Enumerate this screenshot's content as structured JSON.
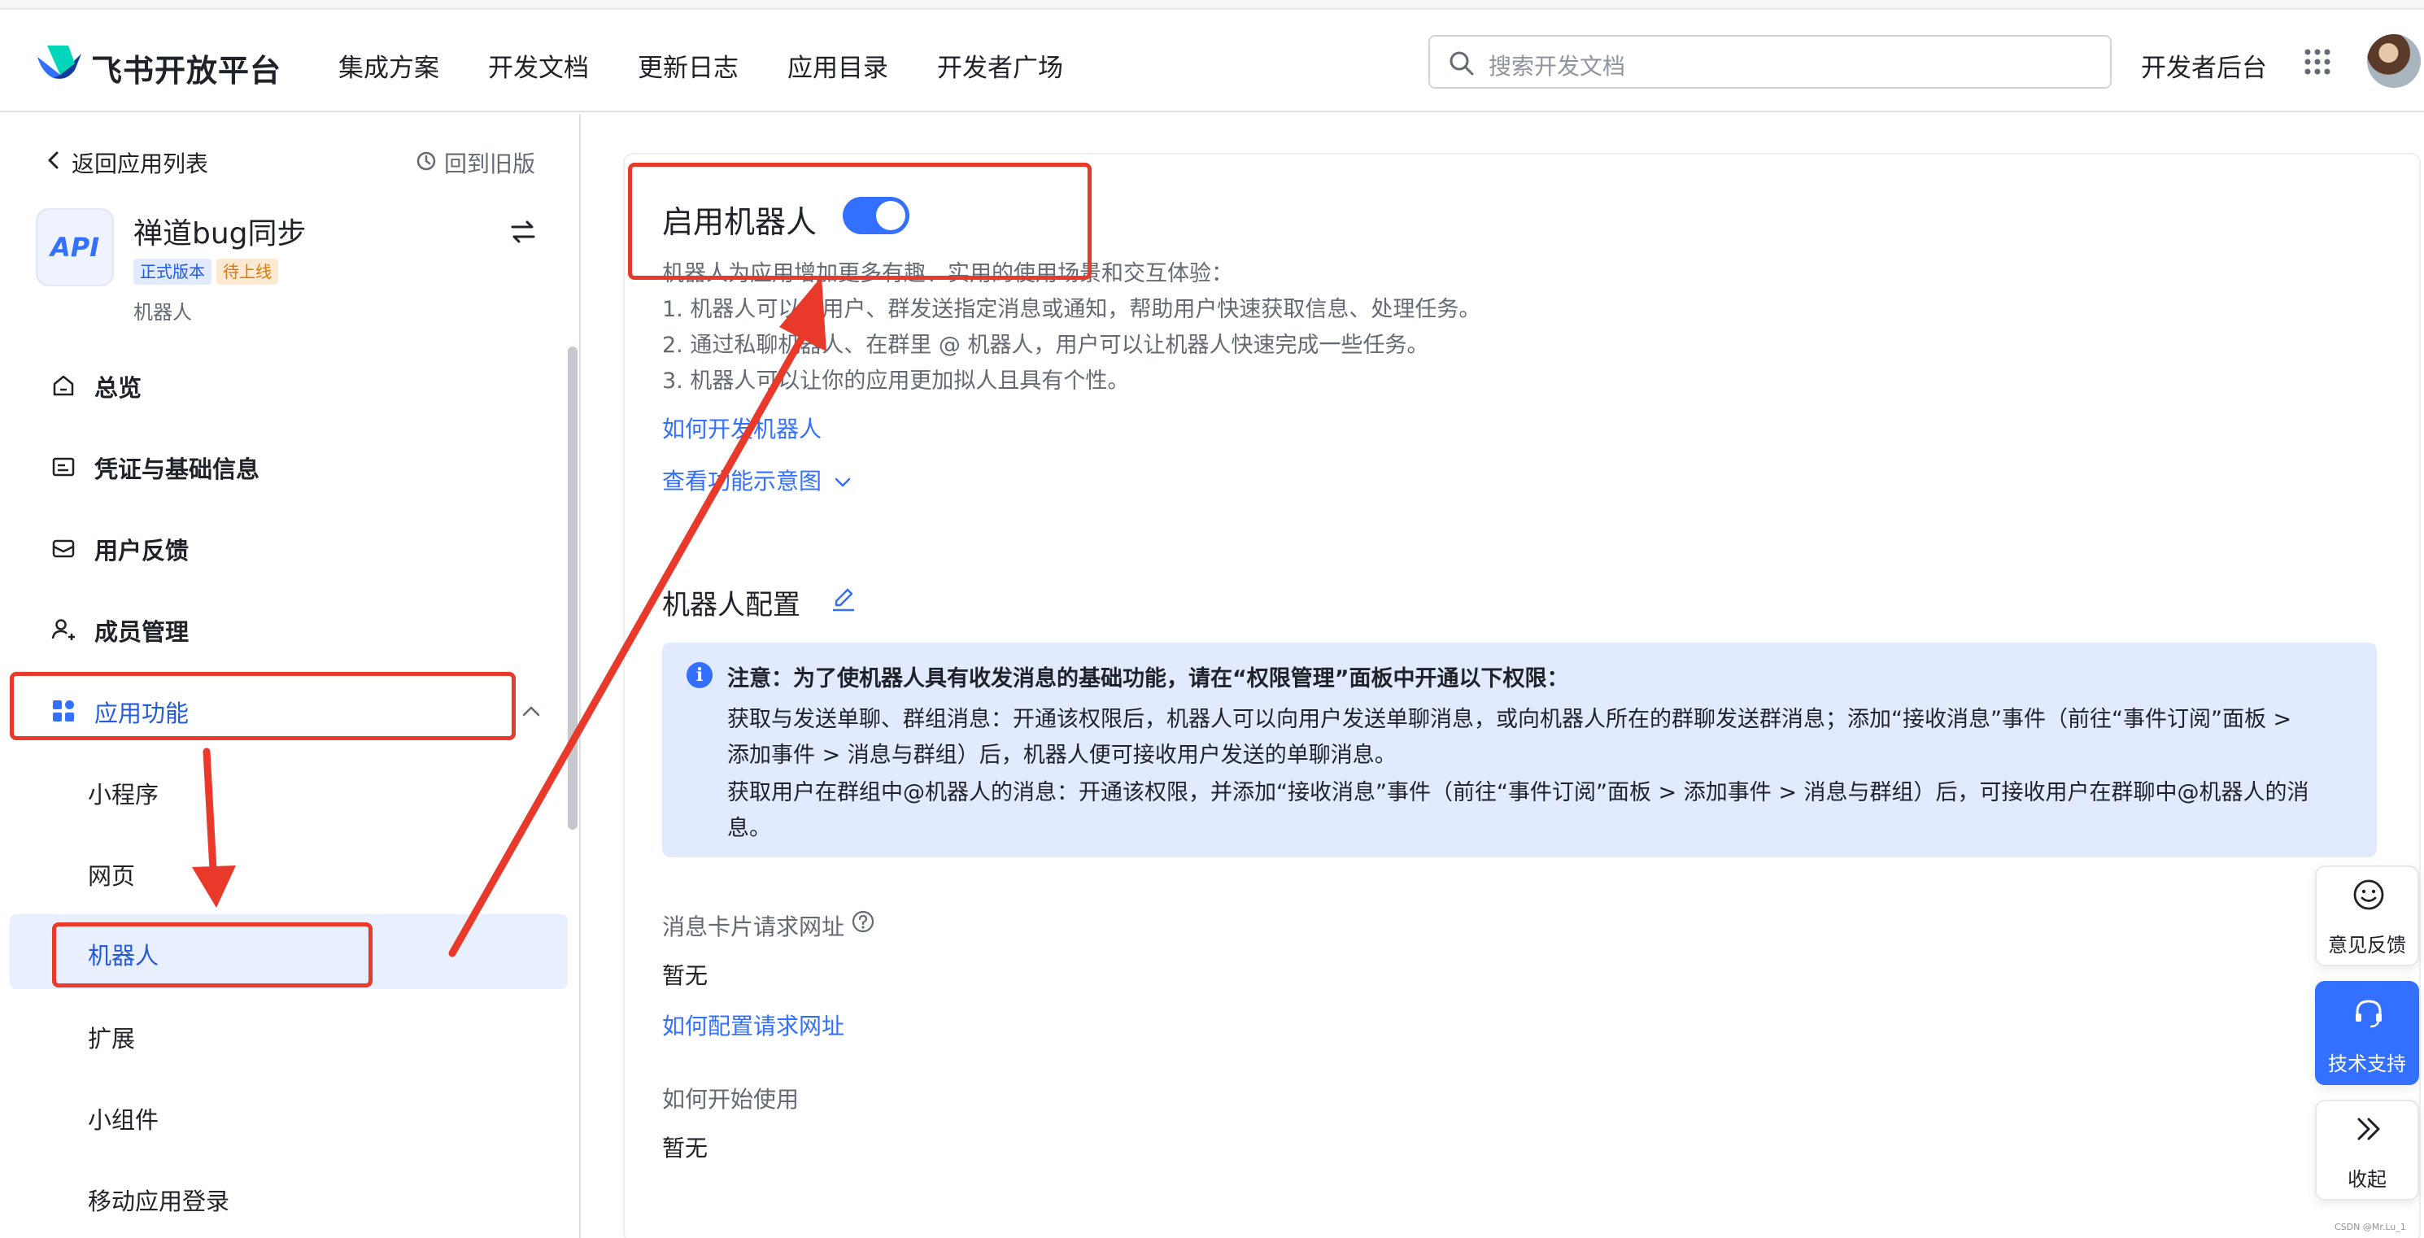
{
  "header": {
    "brand": "飞书开放平台",
    "nav": [
      "集成方案",
      "开发文档",
      "更新日志",
      "应用目录",
      "开发者广场"
    ],
    "search_placeholder": "搜索开发文档",
    "dev_console": "开发者后台"
  },
  "sidebar": {
    "back_label": "返回应用列表",
    "old_version_label": "回到旧版",
    "app": {
      "icon_text": "API",
      "name": "禅道bug同步",
      "badge_release": "正式版本",
      "badge_pending": "待上线",
      "type": "机器人"
    },
    "menu": [
      "总览",
      "凭证与基础信息",
      "用户反馈",
      "成员管理",
      "应用功能"
    ],
    "submenu": [
      "小程序",
      "网页",
      "机器人",
      "扩展",
      "小组件",
      "移动应用登录"
    ],
    "active_submenu": "机器人"
  },
  "main": {
    "bot_title": "启用机器人",
    "bot_enabled": true,
    "desc": [
      "机器人为应用增加更多有趣、实用的使用场景和交互体验：",
      "1. 机器人可以向用户、群发送指定消息或通知，帮助用户快速获取信息、处理任务。",
      "2. 通过私聊机器人、在群里 @ 机器人，用户可以让机器人快速完成一些任务。",
      "3. 机器人可以让你的应用更加拟人且具有个性。"
    ],
    "link_how_to_dev": "如何开发机器人",
    "link_view_demo": "查看功能示意图",
    "config_title": "机器人配置",
    "notice": {
      "title": "注意：为了使机器人具有收发消息的基础功能，请在“权限管理”面板中开通以下权限：",
      "lines": [
        "获取与发送单聊、群组消息：开通该权限后，机器人可以向用户发送单聊消息，或向机器人所在的群聊发送群消息；添加“接收消息”事件（前往“事件订阅”面板 >",
        "添加事件 > 消息与群组）后，机器人便可接收用户发送的单聊消息。",
        "获取用户在群组中@机器人的消息：开通该权限，并添加“接收消息”事件（前往“事件订阅”面板 > 添加事件 > 消息与群组）后，可接收用户在群聊中@机器人的消",
        "息。"
      ]
    },
    "card_url_label": "消息卡片请求网址",
    "card_url_value": "暂无",
    "link_config_url": "如何配置请求网址",
    "how_to_start_label": "如何开始使用",
    "how_to_start_value": "暂无"
  },
  "float": {
    "feedback": "意见反馈",
    "support": "技术支持",
    "collapse": "收起"
  },
  "watermark": "CSDN @Mr.Lu_1",
  "colors": {
    "accent": "#3370ff",
    "annotation": "#e8392b"
  }
}
